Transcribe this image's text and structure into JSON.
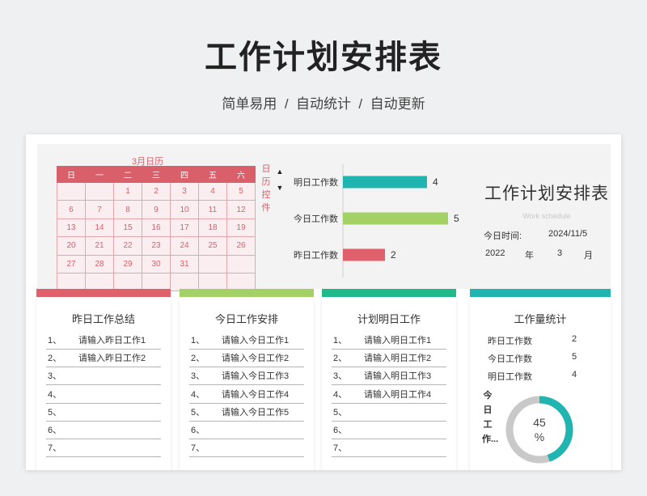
{
  "header": {
    "title": "工作计划安排表",
    "subtitle": "简单易用  /  自动统计  /  自动更新"
  },
  "calendar": {
    "title": "3月日历",
    "weekdays": [
      "日",
      "一",
      "二",
      "三",
      "四",
      "五",
      "六"
    ],
    "weeks": [
      [
        "",
        "",
        "1",
        "2",
        "3",
        "4",
        "5"
      ],
      [
        "6",
        "7",
        "8",
        "9",
        "10",
        "11",
        "12"
      ],
      [
        "13",
        "14",
        "15",
        "16",
        "17",
        "18",
        "19"
      ],
      [
        "20",
        "21",
        "22",
        "23",
        "24",
        "25",
        "26"
      ],
      [
        "27",
        "28",
        "29",
        "30",
        "31",
        "",
        ""
      ],
      [
        "",
        "",
        "",
        "",
        "",
        "",
        ""
      ]
    ],
    "control_label": "日历控件",
    "spin_up": "▲",
    "spin_down": "▼"
  },
  "chart_data": {
    "type": "bar",
    "orientation": "horizontal",
    "categories": [
      "明日工作数",
      "今日工作数",
      "昨日工作数"
    ],
    "values": [
      4,
      5,
      2
    ],
    "colors": [
      "#20b5b0",
      "#a4d165",
      "#e0606b"
    ],
    "xlim": [
      0,
      5
    ],
    "grid": false
  },
  "panel": {
    "title": "工作计划安排表",
    "subtitle": "Work schedule",
    "date_label": "今日时间:",
    "date_value": "2024/11/5",
    "year": "2022",
    "year_unit": "年",
    "month": "3",
    "month_unit": "月"
  },
  "cards": [
    {
      "title": "昨日工作总结",
      "color": "#e0606b",
      "items": [
        {
          "num": "1、",
          "text": "请输入昨日工作1"
        },
        {
          "num": "2、",
          "text": "请输入昨日工作2"
        },
        {
          "num": "3、",
          "text": ""
        },
        {
          "num": "4、",
          "text": ""
        },
        {
          "num": "5、",
          "text": ""
        },
        {
          "num": "6、",
          "text": ""
        },
        {
          "num": "7、",
          "text": ""
        }
      ]
    },
    {
      "title": "今日工作安排",
      "color": "#a4d165",
      "items": [
        {
          "num": "1、",
          "text": "请输入今日工作1"
        },
        {
          "num": "2、",
          "text": "请输入今日工作2"
        },
        {
          "num": "3、",
          "text": "请输入今日工作3"
        },
        {
          "num": "4、",
          "text": "请输入今日工作4"
        },
        {
          "num": "5、",
          "text": "请输入今日工作5"
        },
        {
          "num": "6、",
          "text": ""
        },
        {
          "num": "7、",
          "text": ""
        }
      ]
    },
    {
      "title": "计划明日工作",
      "color": "#1fb98a",
      "items": [
        {
          "num": "1、",
          "text": "请输入明日工作1"
        },
        {
          "num": "2、",
          "text": "请输入明日工作2"
        },
        {
          "num": "3、",
          "text": "请输入明日工作3"
        },
        {
          "num": "4、",
          "text": "请输入明日工作4"
        },
        {
          "num": "5、",
          "text": ""
        },
        {
          "num": "6、",
          "text": ""
        },
        {
          "num": "7、",
          "text": ""
        }
      ]
    }
  ],
  "stats": {
    "title": "工作量统计",
    "color": "#20b5b0",
    "rows": [
      {
        "label": "昨日工作数",
        "value": "2"
      },
      {
        "label": "今日工作数",
        "value": "5"
      },
      {
        "label": "明日工作数",
        "value": "4"
      }
    ],
    "donut_label": "今日工作...",
    "donut_percent_value": 45,
    "donut_percent_num": "45",
    "donut_percent_sign": "%",
    "donut_color": "#20b5b0",
    "donut_track_color": "#c9c9c9"
  }
}
